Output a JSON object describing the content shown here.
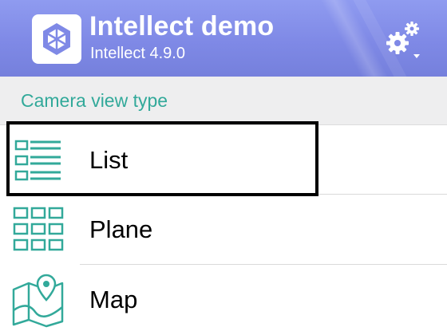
{
  "header": {
    "app_name": "Intellect demo",
    "app_version": "Intellect 4.9.0",
    "app_icon": "app-logo-icon",
    "settings_icon": "gear-icon",
    "background_color": "#7f89e6"
  },
  "section": {
    "title": "Camera view type",
    "accent_color": "#32a99a"
  },
  "items": [
    {
      "label": "List",
      "icon": "list-icon",
      "selected": true
    },
    {
      "label": "Plane",
      "icon": "grid-icon",
      "selected": false
    },
    {
      "label": "Map",
      "icon": "map-icon",
      "selected": false
    }
  ]
}
